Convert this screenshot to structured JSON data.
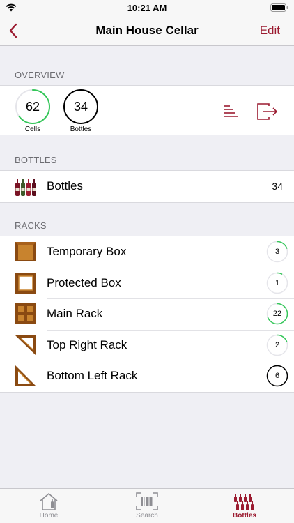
{
  "status_bar": {
    "time": "10:21 AM"
  },
  "nav": {
    "title": "Main House Cellar",
    "edit_label": "Edit"
  },
  "overview": {
    "header": "OVERVIEW",
    "cells": {
      "value": "62",
      "caption": "Cells",
      "fill": 0.65
    },
    "bottles": {
      "value": "34",
      "caption": "Bottles",
      "fill": 1.0
    }
  },
  "bottles_section": {
    "header": "BOTTLES",
    "row": {
      "label": "Bottles",
      "count": "34"
    }
  },
  "racks_section": {
    "header": "RACKS",
    "items": [
      {
        "label": "Temporary Box",
        "count": "3",
        "fill": 0.2,
        "icon": "box-icon"
      },
      {
        "label": "Protected Box",
        "count": "1",
        "fill": 0.08,
        "icon": "protected-box-icon"
      },
      {
        "label": "Main Rack",
        "count": "22",
        "fill": 0.7,
        "icon": "main-rack-icon"
      },
      {
        "label": "Top Right Rack",
        "count": "2",
        "fill": 0.2,
        "icon": "triangle-rack-icon"
      },
      {
        "label": "Bottom Left Rack",
        "count": "6",
        "fill": 1.0,
        "icon": "triangle-rack-icon"
      }
    ]
  },
  "tabs": [
    {
      "label": "Home",
      "active": false
    },
    {
      "label": "Search",
      "active": false
    },
    {
      "label": "Bottles",
      "active": true
    }
  ],
  "colors": {
    "accent": "#9b1b30",
    "ring_green": "#34c759",
    "ring_track": "#e5e5ea"
  }
}
